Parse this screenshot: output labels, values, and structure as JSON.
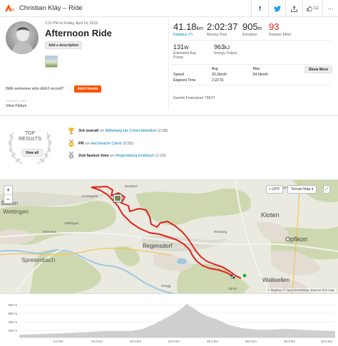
{
  "header": {
    "title": "Christian Kläy – Ride",
    "kudos_count": "12"
  },
  "activity": {
    "date": "2:31 PM on Friday, April 19, 2019",
    "title": "Afternoon Ride",
    "add_description": "Add a description"
  },
  "stats": {
    "distance": {
      "value": "41.18",
      "unit": "km",
      "label": "Distance (?)"
    },
    "moving_time": {
      "value": "2:02:37",
      "label": "Moving Time"
    },
    "elevation": {
      "value": "905",
      "unit": "m",
      "label": "Elevation"
    },
    "relative_effort": {
      "value": "93",
      "label": "Relative Effort"
    },
    "estimated_power": {
      "value": "131",
      "unit": "W",
      "label": "Estimated Avg Power"
    },
    "energy_output": {
      "value": "963",
      "unit": "kJ",
      "label": "Energy Output"
    },
    "table": {
      "headers": [
        "",
        "Avg",
        "Max"
      ],
      "rows": [
        [
          "Speed",
          "20.2km/h",
          "54.0km/h"
        ],
        [
          "Elapsed Time",
          "2:22:31",
          ""
        ]
      ]
    },
    "show_more": "Show More",
    "device": "Garmin Forerunner 735XT"
  },
  "friends": {
    "prompt": "With someone who didn't record?",
    "add_friends": "Add Friends",
    "labs": "STRAVA LABS",
    "flyby": "View Flybys"
  },
  "results": {
    "top_label": "TOP RESULTS",
    "view_all": "View all",
    "achievements": [
      {
        "rank": "3rd overall",
        "prep": "on",
        "segment": "Mittelweg bis Chnechtiwinkel",
        "time": "(2:38)",
        "icon": "trophy-icon"
      },
      {
        "rank": "PR",
        "prep": "on",
        "segment": "Hochwacht Climb",
        "time": "(9:50)",
        "icon": "pr-medal-icon"
      },
      {
        "rank": "2nd fastest time",
        "prep": "on",
        "segment": "Regensberg Endspurt",
        "time": "(1:03)",
        "icon": "silver-medal-icon"
      }
    ]
  },
  "map": {
    "gpx": "GPX",
    "terrain": "Terrain Map",
    "zoom_in": "+",
    "zoom_out": "−",
    "attribution": "© Mapbox © OpenStreetMap Improve this map",
    "places": [
      "Baden",
      "Wettingen",
      "Spreitenbach",
      "Regensdorf",
      "Kloten",
      "Opfikon",
      "Wallisellen",
      "Hochwacht",
      "Höngg",
      "Dielsdorf",
      "Bülach",
      "Rümlang",
      "Otelfingen",
      "Würenlos",
      "Zürich"
    ]
  },
  "elevation_chart": {
    "y_ticks": [
      "800 m",
      "600 m",
      "400 m",
      "200 m"
    ],
    "x_ticks": [
      "5.0 km",
      "10.0 km",
      "15.0 km",
      "20.0 km",
      "25.0 km",
      "30.0 km",
      "35.0 km",
      "40.0 km"
    ]
  },
  "colors": {
    "brand": "#fc5200",
    "link": "#007fb6",
    "route": "#e0231c",
    "relative_effort": "#e0231c"
  }
}
